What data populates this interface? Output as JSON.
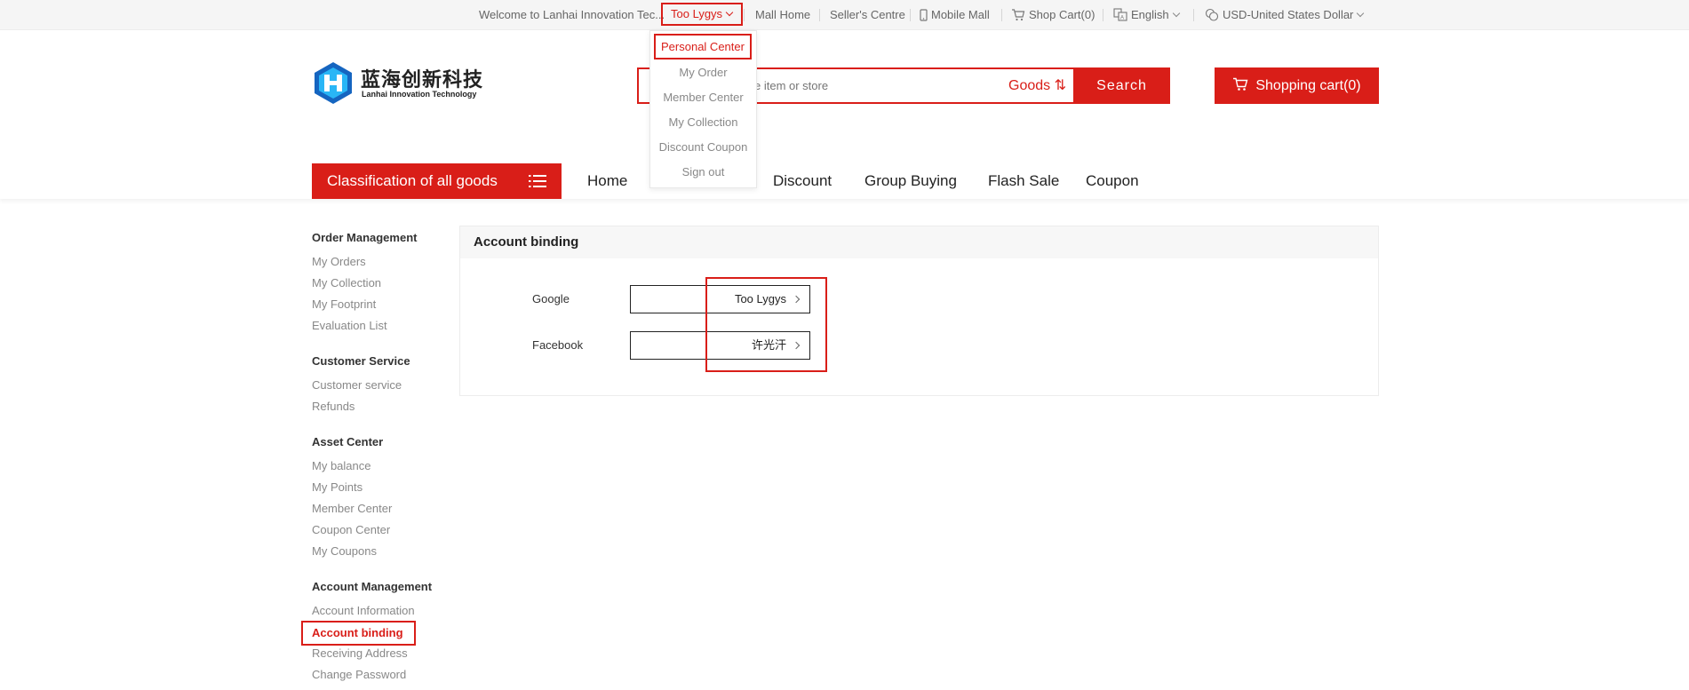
{
  "topbar": {
    "welcome": "Welcome to Lanhai Innovation Tec...",
    "user_name": "Too Lygys",
    "mall_home": "Mall Home",
    "sellers_centre": "Seller's Centre",
    "mobile_mall": "Mobile Mall",
    "shop_cart": "Shop Cart(0)",
    "language": "English",
    "currency": "USD-United States Dollar"
  },
  "user_menu": {
    "items": [
      "Personal Center",
      "My Order",
      "Member Center",
      "My Collection",
      "Discount Coupon",
      "Sign out"
    ],
    "active": "Personal Center"
  },
  "header": {
    "logo_cn": "蓝海创新科技",
    "logo_en": "Lanhai Innovation Technology",
    "search_placeholder": "e item or store",
    "search_type": "Goods ⇅",
    "search_button": "Search",
    "cart_button": "Shopping cart(0)"
  },
  "nav": {
    "classification": "Classification of all goods",
    "items": [
      "Home",
      "Discount",
      "Group Buying",
      "Flash Sale",
      "Coupon"
    ]
  },
  "sidebar": {
    "sections": [
      {
        "title": "Order Management",
        "items": [
          "My Orders",
          "My Collection",
          "My Footprint",
          "Evaluation List"
        ]
      },
      {
        "title": "Customer Service",
        "items": [
          "Customer service",
          "Refunds"
        ]
      },
      {
        "title": "Asset Center",
        "items": [
          "My balance",
          "My Points",
          "Member Center",
          "Coupon Center",
          "My Coupons"
        ]
      },
      {
        "title": "Account Management",
        "items": [
          "Account Information",
          "Account binding",
          "Receiving Address",
          "Change Password"
        ]
      }
    ],
    "active": "Account binding"
  },
  "content": {
    "title": "Account binding",
    "bindings": [
      {
        "platform": "Google",
        "account": "Too Lygys"
      },
      {
        "platform": "Facebook",
        "account": "许光汗"
      }
    ]
  },
  "colors": {
    "accent": "#d91e18"
  }
}
